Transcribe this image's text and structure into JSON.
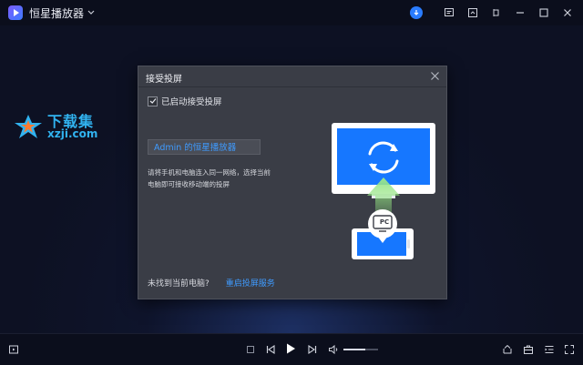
{
  "app": {
    "name": "恒星播放器"
  },
  "watermark": {
    "title": "下载集",
    "url": "xzji.com"
  },
  "dialog": {
    "title": "接受投屏",
    "checkbox_label": "已启动接受投屏",
    "checkbox_checked": true,
    "device_name": "Admin 的恒星播放器",
    "description_line1": "请将手机和电脑连入同一网络，选择当前",
    "description_line2": "电脑即可接收移动端的投屏",
    "not_found_text": "未找到当前电脑?",
    "restart_link": "重启投屏服务",
    "pc_badge": "PC"
  },
  "player": {
    "volume": 0.62
  },
  "colors": {
    "accent": "#2a7cff",
    "link": "#3f9bff",
    "arrow": "#8fe07c"
  }
}
